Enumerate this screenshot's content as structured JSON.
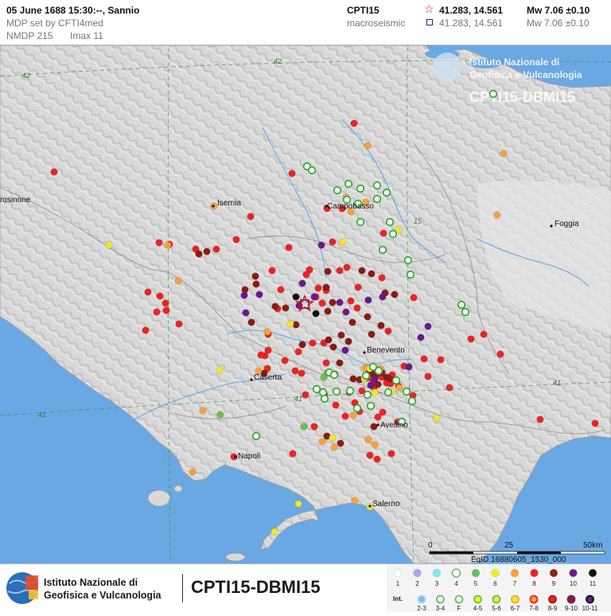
{
  "header": {
    "event_title": "05 June 1688  15:30:--,  Sannio",
    "mdp_set": "MDP set by CFTI4med",
    "nmdp": "NMDP 215",
    "imax": "Imax 11",
    "catalog": "CPTI15",
    "catalog_sub": "macroseismic",
    "epicenter_coords": "41.283, 14.561",
    "epicenter_mw": "Mw 7.06 ±0.10",
    "macro_coords": "41.283, 14.561",
    "macro_mw": "Mw 7.06 ±0.10"
  },
  "map": {
    "places": [
      {
        "name": "Isernia"
      },
      {
        "name": "Campobasso"
      },
      {
        "name": "Foggia"
      },
      {
        "name": "Benevento"
      },
      {
        "name": "Caserta"
      },
      {
        "name": "Avellino"
      },
      {
        "name": "Napoli"
      },
      {
        "name": "Salerno"
      },
      {
        "name": "rosinone"
      }
    ],
    "grid_labels": [
      "42",
      "42",
      "41",
      "41",
      "41",
      "15"
    ],
    "watermark_line1": "Istituto Nazionale di",
    "watermark_line2": "Geofisica e Vulcanologia",
    "watermark_line3": "CPTI15-DBMI15",
    "scale": {
      "start": "0",
      "mid": "25",
      "end": "50km"
    },
    "eqid": "EqID 16880605_1530_000"
  },
  "footer": {
    "institute_line1": "Istituto Nazionale di",
    "institute_line2": "Geofisica e Vulcanologia",
    "title": "CPTI15-DBMI15"
  },
  "legend": {
    "int_label": "Int.",
    "row1": [
      {
        "label": "1",
        "color": "#ffffff"
      },
      {
        "label": "2",
        "color": "#a8a8f0"
      },
      {
        "label": "3",
        "color": "#80e8f0"
      },
      {
        "label": "4",
        "color": "#ffffff"
      },
      {
        "label": "5",
        "color": "#60c060"
      },
      {
        "label": "6",
        "color": "#f0f020"
      },
      {
        "label": "7",
        "color": "#f8a040"
      },
      {
        "label": "8",
        "color": "#f02020"
      },
      {
        "label": "9",
        "color": "#902010"
      },
      {
        "label": "10",
        "color": "#701890"
      },
      {
        "label": "11",
        "color": "#101010"
      }
    ],
    "row2": [
      {
        "label": "2-3",
        "fill": "#a8a8f0",
        "ring": "#80e8f0"
      },
      {
        "label": "3-4",
        "fill": "#ffffff",
        "ring": "#60c060"
      },
      {
        "label": "F",
        "fill": "#ffffff",
        "ring": "#60c060"
      },
      {
        "label": "4-5",
        "fill": "#f0f020",
        "ring": "#60c060"
      },
      {
        "label": "5-6",
        "fill": "#f0f020",
        "ring": "#60c060"
      },
      {
        "label": "6-7",
        "fill": "#f0f020",
        "ring": "#f8a040"
      },
      {
        "label": "7-8",
        "fill": "#f8a040",
        "ring": "#f02020"
      },
      {
        "label": "8-9",
        "fill": "#f02020",
        "ring": "#902010"
      },
      {
        "label": "9-10",
        "fill": "#902010",
        "ring": "#701890"
      },
      {
        "label": "10-11",
        "fill": "#701890",
        "ring": "#101010"
      }
    ]
  },
  "colors": {
    "sea": "#6aa8e4",
    "land": "#dcdcdc",
    "int4_ring": "#3aaa3a",
    "int5": "#6cc04a",
    "int6": "#f2e62a",
    "int7": "#f7a23c",
    "int8": "#ee2222",
    "int9": "#8a1c12",
    "int10": "#6a1890",
    "int11": "#111111",
    "epicenter_star": "#e01010"
  }
}
